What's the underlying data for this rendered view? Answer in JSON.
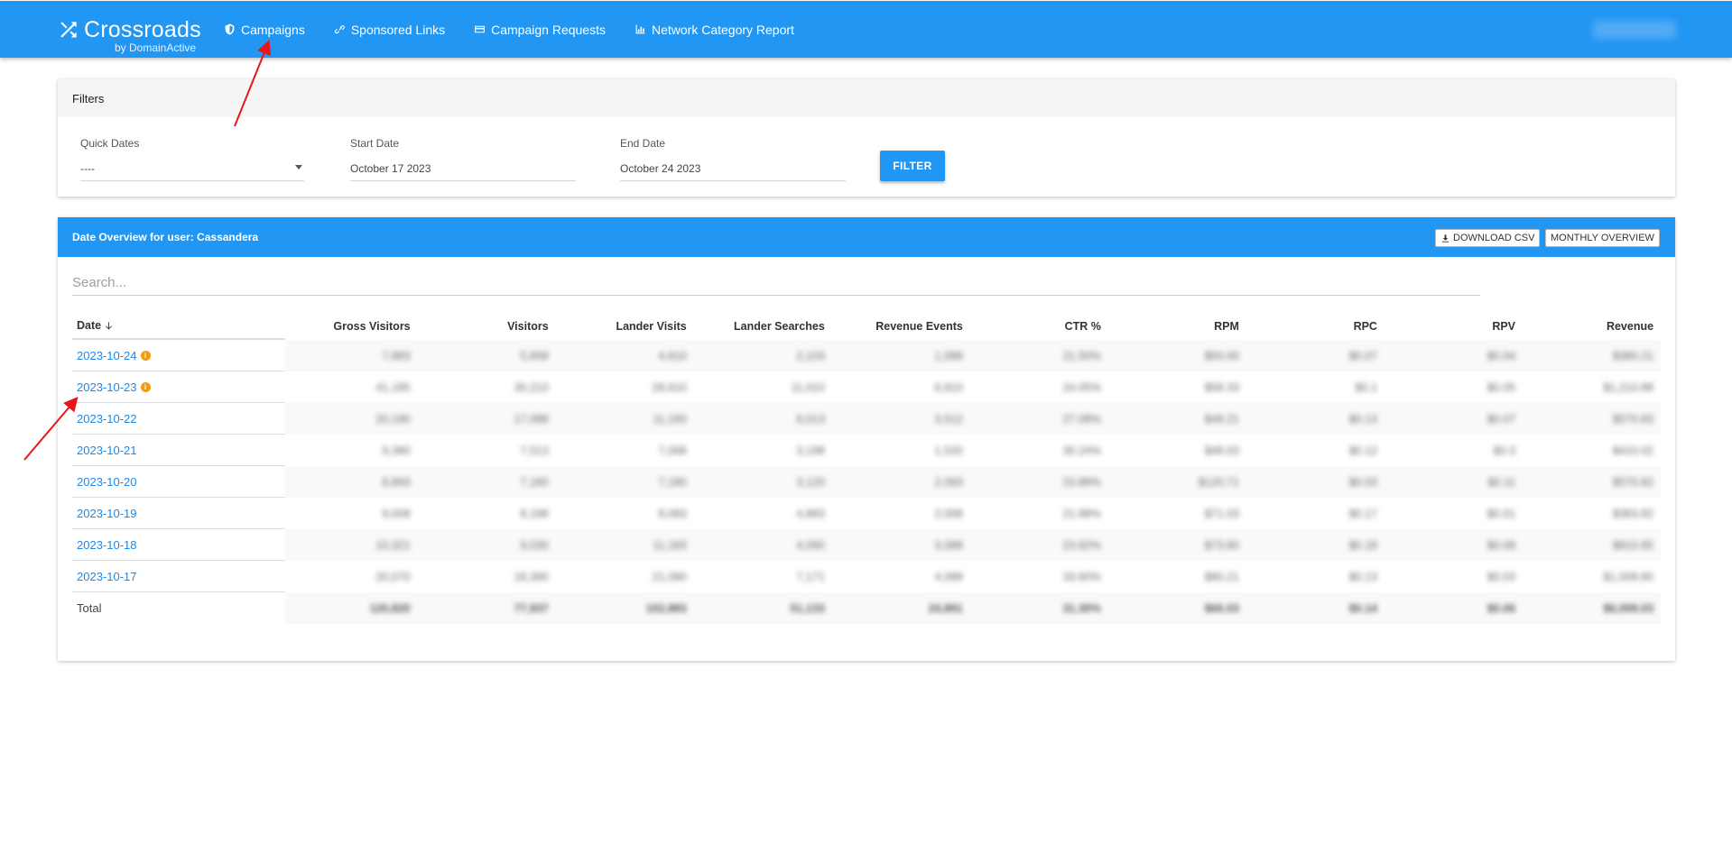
{
  "brand": {
    "name": "Crossroads",
    "sub": "by DomainActive"
  },
  "nav": [
    {
      "label": "Campaigns",
      "icon": "shield-icon"
    },
    {
      "label": "Sponsored Links",
      "icon": "link-icon"
    },
    {
      "label": "Campaign Requests",
      "icon": "card-icon"
    },
    {
      "label": "Network Category Report",
      "icon": "bar-chart-icon"
    }
  ],
  "filters": {
    "title": "Filters",
    "quick_dates": {
      "label": "Quick Dates",
      "value": "----"
    },
    "start_date": {
      "label": "Start Date",
      "value": "October 17 2023"
    },
    "end_date": {
      "label": "End Date",
      "value": "October 24 2023"
    },
    "filter_label": "FILTER"
  },
  "overview": {
    "title": "Date Overview for user: Cassandera",
    "download_label": "DOWNLOAD CSV",
    "monthly_label": "MONTHLY OVERVIEW",
    "search_placeholder": "Search...",
    "columns": [
      "Date",
      "Gross Visitors",
      "Visitors",
      "Lander Visits",
      "Lander Searches",
      "Revenue Events",
      "CTR %",
      "RPM",
      "RPC",
      "RPV",
      "Revenue"
    ],
    "rows": [
      {
        "date": "2023-10-24",
        "info": true,
        "values": [
          "7,883",
          "5,958",
          "4,910",
          "2,103",
          "1,088",
          "21.50%",
          "$50.00",
          "$0.07",
          "$0.04",
          "$380.21"
        ]
      },
      {
        "date": "2023-10-23",
        "info": true,
        "values": [
          "41,185",
          "30,210",
          "28,910",
          "11,010",
          "6,910",
          "24.05%",
          "$58.33",
          "$0.1",
          "$0.05",
          "$1,210.88"
        ]
      },
      {
        "date": "2023-10-22",
        "info": false,
        "values": [
          "20,190",
          "17,088",
          "11,183",
          "6,013",
          "3,512",
          "27.08%",
          "$48.21",
          "$0.13",
          "$0.07",
          "$570.83"
        ]
      },
      {
        "date": "2023-10-21",
        "info": false,
        "values": [
          "9,380",
          "7,513",
          "7,068",
          "3,198",
          "1,520",
          "30.24%",
          "$48.03",
          "$0.12",
          "$0.3",
          "$410.02"
        ]
      },
      {
        "date": "2023-10-20",
        "info": false,
        "values": [
          "8,893",
          "7,180",
          "7,180",
          "3,120",
          "2,093",
          "23.88%",
          "$120.71",
          "$0.03",
          "$0.11",
          "$570.82"
        ]
      },
      {
        "date": "2023-10-19",
        "info": false,
        "values": [
          "9,008",
          "8,198",
          "8,083",
          "4,883",
          "2,008",
          "21.88%",
          "$71.03",
          "$0.17",
          "$0.01",
          "$383.82"
        ]
      },
      {
        "date": "2023-10-18",
        "info": false,
        "values": [
          "10,321",
          "9,030",
          "11,183",
          "4,090",
          "3,088",
          "23.82%",
          "$73.80",
          "$0.18",
          "$0.08",
          "$810.85"
        ]
      },
      {
        "date": "2023-10-17",
        "info": false,
        "values": [
          "20,070",
          "18,390",
          "21,080",
          "7,171",
          "4,088",
          "33.60%",
          "$80.21",
          "$0.13",
          "$0.03",
          "$1,008.80"
        ]
      }
    ],
    "total": {
      "label": "Total",
      "values": [
        "120,820",
        "77,937",
        "102,883",
        "51,133",
        "24,891",
        "31.30%",
        "$66.03",
        "$0.14",
        "$0.06",
        "$6,008.03"
      ]
    }
  },
  "colors": {
    "primary": "#2196f3",
    "link": "#1e88e5",
    "info": "#f39c12",
    "annotation": "#e8161b"
  }
}
